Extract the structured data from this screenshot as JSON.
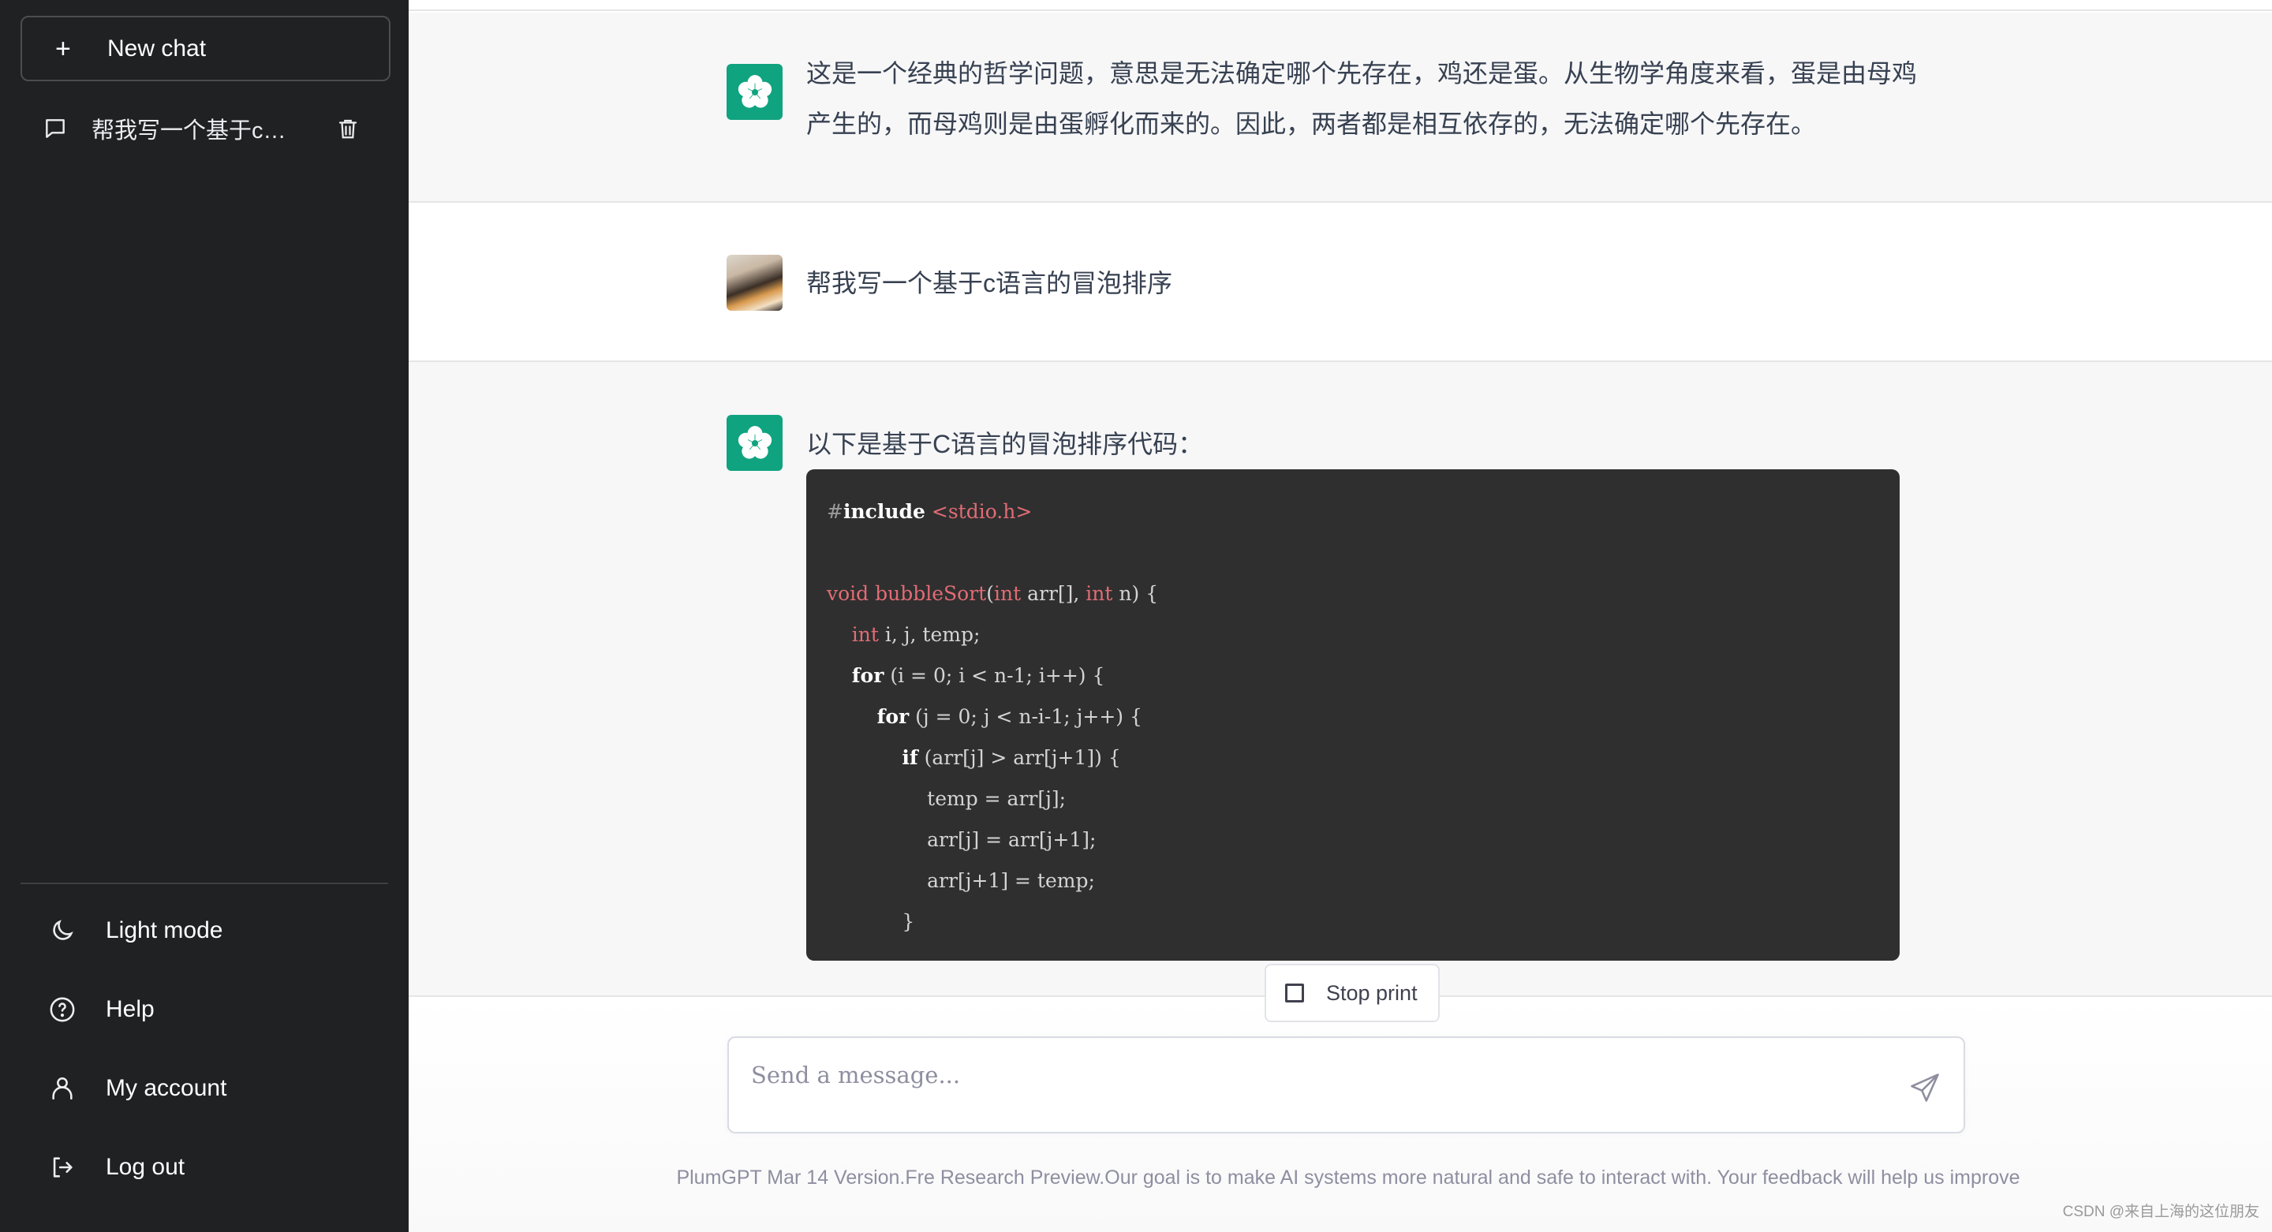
{
  "sidebar": {
    "new_chat_label": "New chat",
    "new_chat_icon": "plus-icon",
    "conversations": [
      {
        "title": "帮我写一个基于c语言的冒泡排序",
        "display_title": "帮我写一个基于c语...",
        "icon": "message-icon",
        "action_icon": "trash-icon"
      }
    ],
    "menu": [
      {
        "label": "Light mode",
        "icon": "moon-icon"
      },
      {
        "label": "Help",
        "icon": "help-circle-icon"
      },
      {
        "label": "My account",
        "icon": "user-icon"
      },
      {
        "label": "Log out",
        "icon": "logout-icon"
      }
    ]
  },
  "conversation": {
    "messages": [
      {
        "role": "assistant",
        "avatar": "plum-blossom-icon",
        "text": "这是一个经典的哲学问题，意思是无法确定哪个先存在，鸡还是蛋。从生物学角度来看，蛋是由母鸡产生的，而母鸡则是由蛋孵化而来的。因此，两者都是相互依存的，无法确定哪个先存在。"
      },
      {
        "role": "user",
        "avatar": "user-photo-avatar",
        "text": "帮我写一个基于c语言的冒泡排序"
      },
      {
        "role": "assistant",
        "avatar": "plum-blossom-icon",
        "text": "以下是基于C语言的冒泡排序代码：",
        "code": {
          "language": "c",
          "lines": [
            "#include <stdio.h>",
            "",
            "void bubbleSort(int arr[], int n) {",
            "    int i, j, temp;",
            "    for (i = 0; i < n-1; i++) {",
            "        for (j = 0; j < n-i-1; j++) {",
            "            if (arr[j] > arr[j+1]) {",
            "                temp = arr[j];",
            "                arr[j] = arr[j+1];",
            "                arr[j+1] = temp;",
            "            }"
          ]
        }
      }
    ]
  },
  "stop_button": {
    "label": "Stop print",
    "icon": "stop-square-icon"
  },
  "composer": {
    "placeholder": "Send a message...",
    "value": "",
    "send_icon": "send-icon"
  },
  "footer_note": "PlumGPT Mar 14 Version.Fre Research Preview.Our goal is to make AI systems more natural and safe to interact with. Your feedback will help us improve",
  "watermark": "CSDN @来自上海的这位朋友",
  "colors": {
    "sidebar_bg": "#202123",
    "brand_green": "#10a37f",
    "code_bg": "#2f2f2f",
    "ai_message_bg": "#f7f7f8",
    "keyword_red": "#e06c75"
  }
}
